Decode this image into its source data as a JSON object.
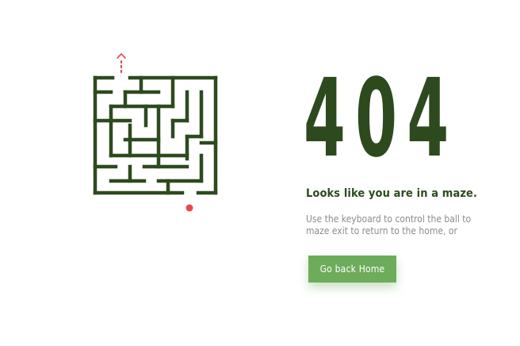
{
  "error": {
    "code": "404",
    "heading": "Looks like you are in a maze.",
    "description": "Use the keyboard to control the ball to maze exit to return to the home, or",
    "button_label": "Go back Home"
  },
  "colors": {
    "maze_wall": "#2d4a1e",
    "ball": "#e8474f",
    "exit_arrow": "#e8474f",
    "button_bg": "#6dac5a",
    "text_primary": "#2d4a1e",
    "text_secondary": "#8c8c8c"
  },
  "icons": {
    "ball": "red-ball-icon",
    "exit": "exit-arrow-icon"
  }
}
